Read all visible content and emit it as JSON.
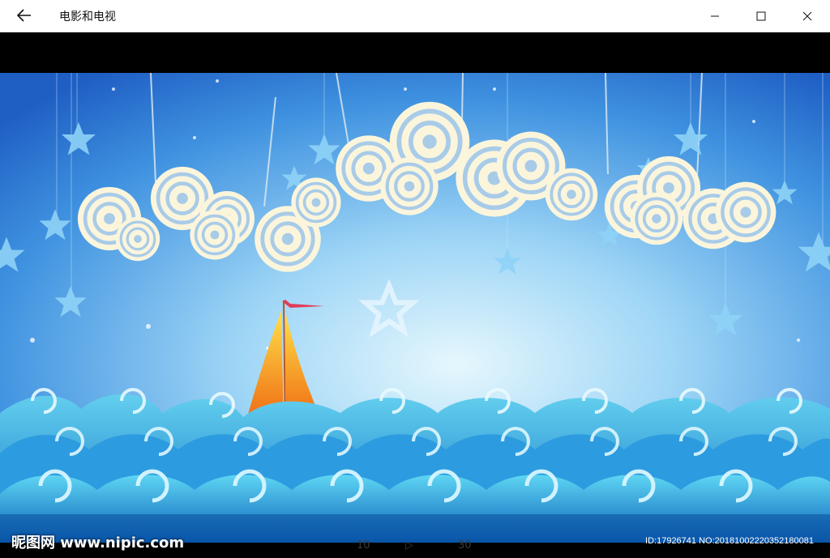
{
  "window": {
    "title": "电影和电视",
    "back_icon": "arrow-left-icon",
    "minimize_icon": "minimize-icon",
    "maximize_icon": "maximize-icon",
    "close_icon": "close-icon"
  },
  "video": {
    "watermark_logo": "昵图网 www.nipic.com",
    "watermark_id": "ID:17926741 NO:20181002220352180081"
  },
  "controls": {
    "skip_back_label": "10",
    "skip_forward_label": "30"
  },
  "colors": {
    "sky_top": "#2a7ad6",
    "sky_bottom": "#d7f0fb",
    "wave_dark": "#0b5fb3",
    "wave_light": "#47c4ef",
    "cloud": "#fbf5dc",
    "sail": "#f5a623"
  }
}
